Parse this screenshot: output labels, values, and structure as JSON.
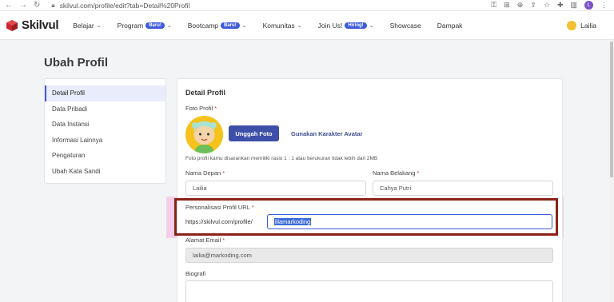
{
  "browser": {
    "url": "skilvul.com/profile/edit?tab=Detail%20Profil",
    "profile_initial": "L"
  },
  "header": {
    "logo_text": "Skilvul",
    "nav": [
      {
        "label": "Belajar",
        "badge": "",
        "chevron": true
      },
      {
        "label": "Program",
        "badge": "Baru!",
        "chevron": true
      },
      {
        "label": "Bootcamp",
        "badge": "Baru!",
        "chevron": true
      },
      {
        "label": "Komunitas",
        "badge": "",
        "chevron": true
      },
      {
        "label": "Join Us!",
        "badge": "Hiring!",
        "chevron": true
      },
      {
        "label": "Showcase",
        "badge": "",
        "chevron": false
      },
      {
        "label": "Dampak",
        "badge": "",
        "chevron": false
      }
    ],
    "user_name": "Lailia"
  },
  "page": {
    "title": "Ubah Profil"
  },
  "sidebar": {
    "items": [
      {
        "label": "Detail Profil",
        "active": true
      },
      {
        "label": "Data Pribadi",
        "active": false
      },
      {
        "label": "Data Instansi",
        "active": false
      },
      {
        "label": "Informasi Lainnya",
        "active": false
      },
      {
        "label": "Pengaturan",
        "active": false
      },
      {
        "label": "Ubah Kata Sandi",
        "active": false
      }
    ]
  },
  "form": {
    "section_title": "Detail Profil",
    "photo_label": "Foto Profil",
    "upload_button": "Unggah Foto",
    "avatar_link": "Gunakan Karakter Avatar",
    "photo_hint": "Foto profil kamu disarankan memiliki rasio 1 : 1 atau berukuran tidak lebih dari 2MB",
    "first_name_label": "Nama Depan",
    "first_name_value": "Lailia",
    "last_name_label": "Nama Belakang",
    "last_name_value": "Cahya Putri",
    "url_label": "Personalisasi Profil URL",
    "url_prefix": "https://skilvul.com/profile/",
    "url_value": "lilamarkoding",
    "email_label": "Alamat Email",
    "email_value": "lailia@markoding.com",
    "bio_label": "Biografi",
    "required_mark": "*"
  },
  "colors": {
    "brand_blue": "#3d4fa8",
    "badge_blue": "#3d5bd9",
    "highlight_red": "#8a2218",
    "highlight_pink": "#f6b0dc"
  }
}
